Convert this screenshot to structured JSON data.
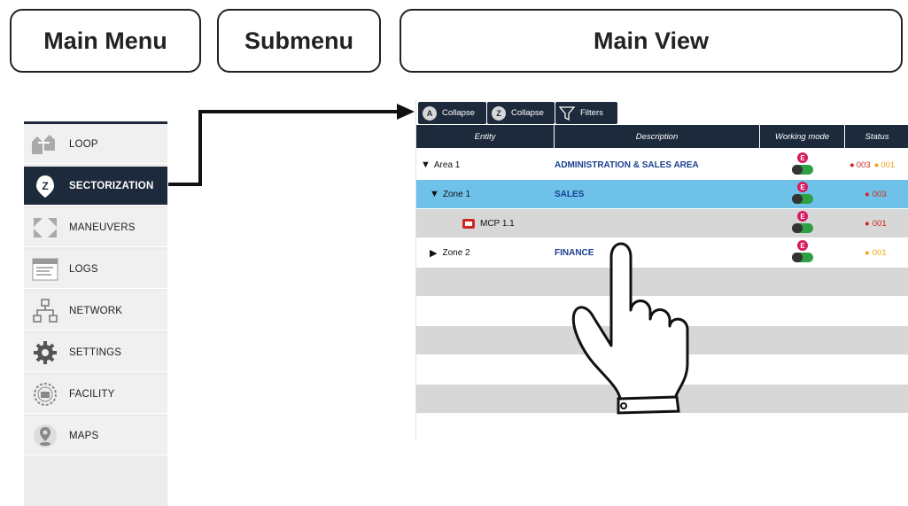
{
  "callouts": {
    "main_menu": "Main Menu",
    "submenu": "Submenu",
    "main_view": "Main View"
  },
  "sidebar": {
    "items": [
      {
        "label": "LOOP",
        "icon": "loop-icon"
      },
      {
        "label": "SECTORIZATION",
        "icon": "sectorization-icon",
        "active": true
      },
      {
        "label": "MANEUVERS",
        "icon": "maneuvers-icon"
      },
      {
        "label": "LOGS",
        "icon": "logs-icon"
      },
      {
        "label": "NETWORK",
        "icon": "network-icon"
      },
      {
        "label": "SETTINGS",
        "icon": "settings-icon"
      },
      {
        "label": "FACILITY",
        "icon": "facility-icon"
      },
      {
        "label": "MAPS",
        "icon": "maps-icon"
      }
    ]
  },
  "toolbar": {
    "collapse_a": "Collapse",
    "collapse_a_badge": "A",
    "collapse_z": "Collapse",
    "collapse_z_badge": "Z",
    "filters": "Filters"
  },
  "table": {
    "headers": [
      "Entity",
      "Description",
      "Working mode",
      "Status"
    ],
    "rows": [
      {
        "entity": "Area 1",
        "description": "ADMINISTRATION & SALES AREA",
        "status_red": "003",
        "status_orange": "001"
      },
      {
        "entity": "Zone 1",
        "description": "SALES",
        "status_red": "003"
      },
      {
        "entity": "MCP 1.1",
        "description": "",
        "status_red": "001"
      },
      {
        "entity": "Zone 2",
        "description": "FINANCE",
        "status_orange": "001"
      }
    ],
    "working_mode_badge": "E"
  },
  "colors": {
    "navy": "#1c2a3c",
    "selected_row": "#6ec1e8",
    "status_red": "#d0261f",
    "status_orange": "#f0a41b"
  }
}
